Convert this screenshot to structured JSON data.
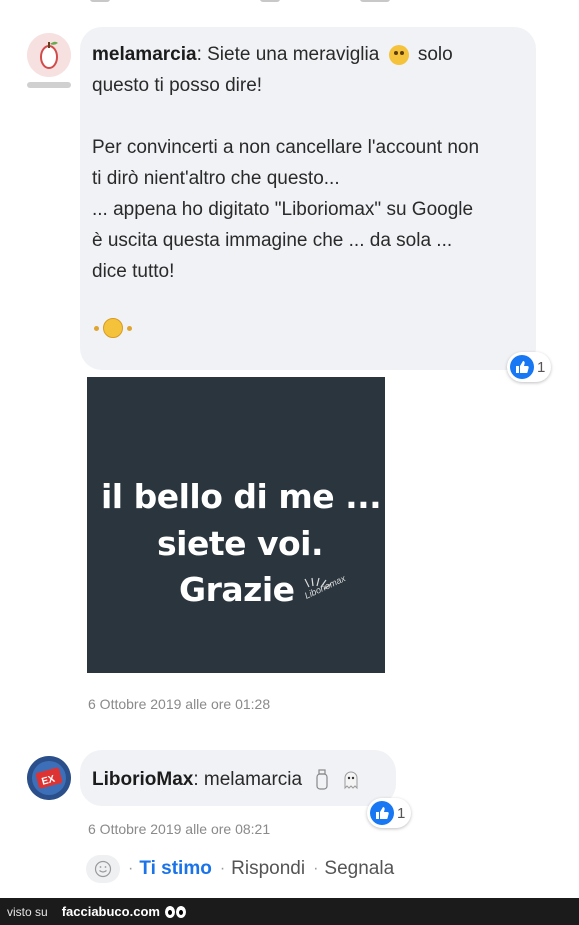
{
  "comment1": {
    "author": "melamarcia",
    "line1a": ": Siete una meraviglia",
    "line1b": "solo",
    "line2": "questo ti posso dire!",
    "para2_line1": "Per convincerti a non cancellare l'account non",
    "para2_line2": "ti dirò nient'altro che questo...",
    "para2_line3": "... appena ho digitato \"Liboriomax\" su Google",
    "para2_line4": "è uscita questa immagine che ... da sola ...",
    "para2_line5": "dice tutto!",
    "likes": "1",
    "image": {
      "line1": "il bello di me ...",
      "line2": "siete voi.",
      "line3": "Grazie",
      "watermark": "Liboriomax"
    },
    "date": "6 Ottobre 2019 alle ore 01:28"
  },
  "comment2": {
    "author": "LiborioMax",
    "text": ": melamarcia",
    "likes": "1",
    "date": "6 Ottobre 2019 alle ore 08:21"
  },
  "actions": {
    "like": "Ti stimo",
    "reply": "Rispondi",
    "report": "Segnala",
    "separator": "·"
  },
  "footer": {
    "visto": "visto su",
    "brand": "facciabuco.com"
  },
  "colors": {
    "bubble": "#f0f2f5",
    "like_blue": "#1877f2",
    "link_blue": "#1a73e8",
    "image_bg": "#2a353e",
    "footer_bg": "#1b1b1b"
  },
  "icons": [
    "apple-avatar-icon",
    "smiley-emoji-icon",
    "like-thumb-icon",
    "ghost-emoji-icon",
    "eyes-logo-icon"
  ]
}
